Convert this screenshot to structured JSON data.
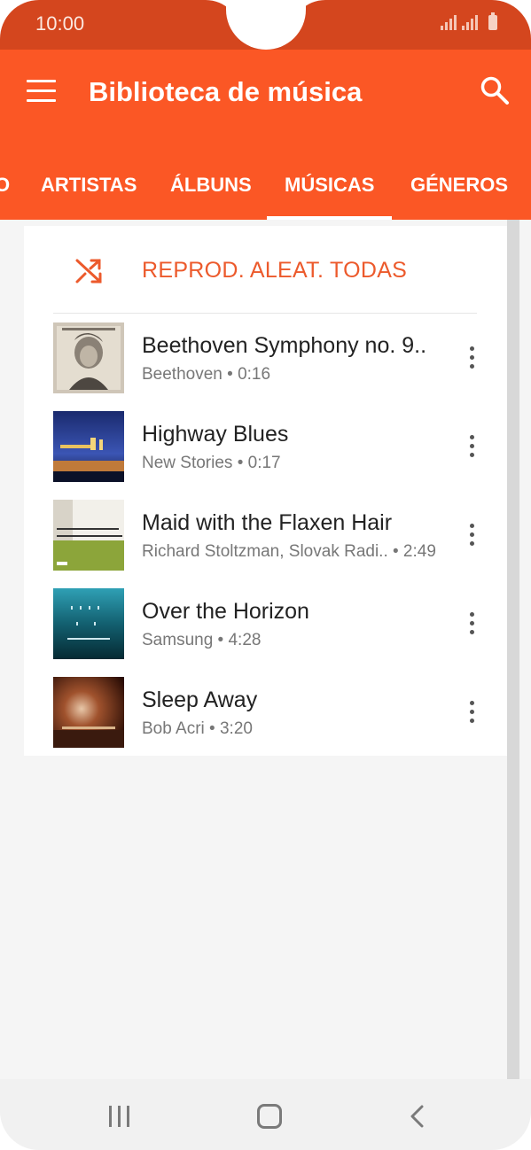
{
  "status_bar": {
    "time": "10:00"
  },
  "app_bar": {
    "title": "Biblioteca de música"
  },
  "tabs": [
    {
      "label": "O"
    },
    {
      "label": "ARTISTAS"
    },
    {
      "label": "ÁLBUNS"
    },
    {
      "label": "MÚSICAS",
      "selected": true
    },
    {
      "label": "GÉNEROS"
    }
  ],
  "shuffle": {
    "label": "REPROD. ALEAT. TODAS"
  },
  "songs": [
    {
      "title": "Beethoven Symphony no. 9..",
      "artist": "Beethoven",
      "duration": "0:16",
      "subtitle": "Beethoven • 0:16",
      "art_icon": "beethoven-portrait"
    },
    {
      "title": "Highway Blues",
      "artist": "New Stories",
      "duration": "0:17",
      "subtitle": "New Stories • 0:17",
      "art_icon": "blue-night-cover"
    },
    {
      "title": "Maid with the Flaxen Hair",
      "artist": "Richard Stoltzman, Slovak Radi..",
      "duration": "2:49",
      "subtitle": "Richard Stoltzman, Slovak Radi..  • 2:49",
      "art_icon": "richard-stoltzman-cover"
    },
    {
      "title": "Over the Horizon",
      "artist": "Samsung",
      "duration": "4:28",
      "subtitle": "Samsung • 4:28",
      "art_icon": "over-the-horizon-cover"
    },
    {
      "title": "Sleep Away",
      "artist": "Bob Acri",
      "duration": "3:20",
      "subtitle": "Bob Acri • 3:20",
      "art_icon": "sleep-away-cover"
    }
  ],
  "colors": {
    "status_bar": "#d4461e",
    "app_bar": "#fb5725",
    "accent": "#ec5a2c"
  }
}
